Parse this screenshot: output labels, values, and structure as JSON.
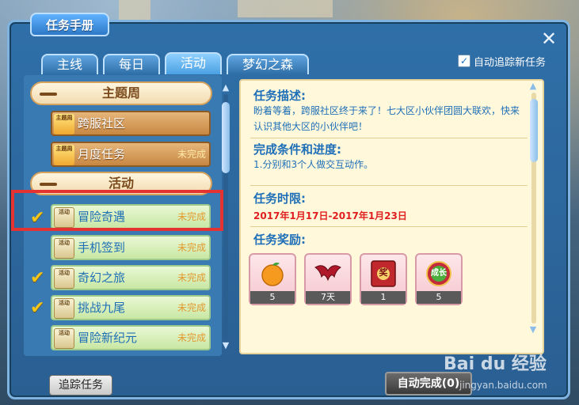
{
  "window": {
    "title": "任务手册",
    "close_glyph": "✕"
  },
  "tabs": [
    {
      "label": "主线",
      "active": false
    },
    {
      "label": "每日",
      "active": false
    },
    {
      "label": "活动",
      "active": true
    },
    {
      "label": "梦幻之森",
      "active": false
    }
  ],
  "auto_track": {
    "label": "自动追踪新任务",
    "checked": true,
    "check_glyph": "✓"
  },
  "left": {
    "categories": [
      {
        "label": "主题周"
      },
      {
        "label": "活动"
      }
    ],
    "theme_quests": [
      {
        "name": "跨服社区",
        "status": "",
        "icon_text": "主题周"
      },
      {
        "name": "月度任务",
        "status": "未完成",
        "icon_text": "主题周"
      }
    ],
    "activity_quests": [
      {
        "name": "冒险奇遇",
        "status": "未完成",
        "icon_text": "活动",
        "tracked": true
      },
      {
        "name": "手机签到",
        "status": "未完成",
        "icon_text": "活动",
        "tracked": false
      },
      {
        "name": "奇幻之旅",
        "status": "未完成",
        "icon_text": "活动",
        "tracked": true
      },
      {
        "name": "挑战九尾",
        "status": "未完成",
        "icon_text": "活动",
        "tracked": true
      },
      {
        "name": "冒险新纪元",
        "status": "未完成",
        "icon_text": "活动",
        "tracked": false
      }
    ],
    "tick_glyph": "✔",
    "scroll_up": "▲",
    "scroll_down": "▼"
  },
  "detail": {
    "desc_heading": "任务描述:",
    "desc_text": "盼着等着，跨服社区终于来了！七大区小伙伴团圆大联欢，快来认识其他大区的小伙伴吧！",
    "cond_heading": "完成条件和进度:",
    "cond_text": "1.分别和3个人做交互动作。",
    "limit_heading": "任务时限:",
    "limit_text": "2017年1月17日-2017年1月23日",
    "reward_heading": "任务奖励:",
    "rewards": [
      {
        "count": "5",
        "color": "#f59a1e",
        "icon": "orange-fruit"
      },
      {
        "count": "7天",
        "color": "#b0182a",
        "icon": "red-wings"
      },
      {
        "count": "1",
        "color": "#c0282e",
        "icon": "red-card"
      },
      {
        "count": "5",
        "color": "#c32a3a",
        "icon": "growth-badge"
      }
    ],
    "reward_badge_text": "成长",
    "reward_card_text": "奖"
  },
  "buttons": {
    "track": "追踪任务",
    "auto_complete": "自动完成(0)"
  },
  "watermark": {
    "brand": "Bai du 经验",
    "url": "jingyan.baidu.com"
  }
}
